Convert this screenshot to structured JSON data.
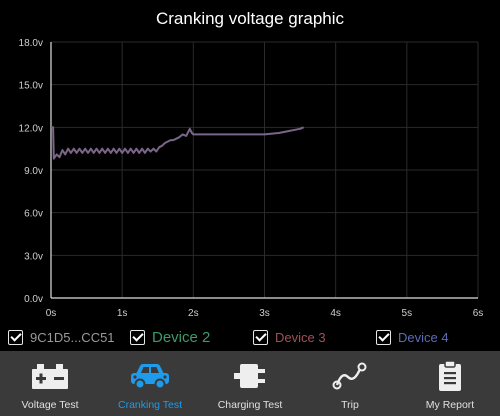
{
  "chart_data": {
    "type": "line",
    "title": "Cranking voltage graphic",
    "xlabel": "",
    "ylabel": "",
    "x_ticks": [
      "0s",
      "1s",
      "2s",
      "3s",
      "4s",
      "5s",
      "6s"
    ],
    "y_ticks": [
      "0.0v",
      "3.0v",
      "6.0v",
      "9.0v",
      "12.0v",
      "15.0v",
      "18.0v"
    ],
    "xlim": [
      0,
      6
    ],
    "ylim": [
      0,
      18
    ],
    "grid": true,
    "series": [
      {
        "name": "9C1D5...CC51",
        "color": "#7a6688",
        "x": [
          0,
          0.03,
          0.04,
          0.08,
          0.12,
          0.16,
          0.2,
          0.24,
          0.28,
          0.32,
          0.36,
          0.4,
          0.44,
          0.48,
          0.52,
          0.56,
          0.6,
          0.64,
          0.68,
          0.72,
          0.76,
          0.8,
          0.84,
          0.88,
          0.92,
          0.96,
          1.0,
          1.04,
          1.08,
          1.12,
          1.16,
          1.2,
          1.24,
          1.28,
          1.32,
          1.36,
          1.4,
          1.44,
          1.48,
          1.52,
          1.56,
          1.6,
          1.64,
          1.68,
          1.72,
          1.76,
          1.8,
          1.85,
          1.9,
          1.95,
          1.98,
          2.0,
          2.05,
          2.1,
          2.2,
          2.4,
          2.6,
          2.8,
          3.0,
          3.2,
          3.3,
          3.4,
          3.5,
          3.55
        ],
        "y": [
          12.0,
          12.0,
          9.8,
          10.1,
          9.9,
          10.4,
          10.1,
          10.5,
          10.2,
          10.5,
          10.2,
          10.5,
          10.2,
          10.5,
          10.2,
          10.5,
          10.2,
          10.5,
          10.2,
          10.5,
          10.2,
          10.5,
          10.2,
          10.5,
          10.2,
          10.5,
          10.2,
          10.5,
          10.2,
          10.5,
          10.2,
          10.5,
          10.2,
          10.5,
          10.2,
          10.5,
          10.3,
          10.5,
          10.3,
          10.6,
          10.7,
          10.9,
          11.0,
          11.1,
          11.1,
          11.2,
          11.3,
          11.5,
          11.4,
          11.9,
          11.6,
          11.5,
          11.5,
          11.5,
          11.5,
          11.5,
          11.5,
          11.5,
          11.5,
          11.6,
          11.7,
          11.8,
          11.9,
          12.0
        ]
      }
    ]
  },
  "legend": [
    {
      "label": "9C1D5...CC51",
      "color": "#9a9a9a"
    },
    {
      "label": "Device 2",
      "color": "#3e9a6a"
    },
    {
      "label": "Device 3",
      "color": "#a05058"
    },
    {
      "label": "Device 4",
      "color": "#5a6cb8"
    }
  ],
  "nav": {
    "items": [
      {
        "label": "Voltage Test",
        "icon": "battery-icon",
        "active": false
      },
      {
        "label": "Cranking Test",
        "icon": "car-icon",
        "active": true
      },
      {
        "label": "Charging Test",
        "icon": "plug-icon",
        "active": false
      },
      {
        "label": "Trip",
        "icon": "route-icon",
        "active": false
      },
      {
        "label": "My Report",
        "icon": "clipboard-icon",
        "active": false
      }
    ],
    "active_color": "#1e9bea"
  }
}
